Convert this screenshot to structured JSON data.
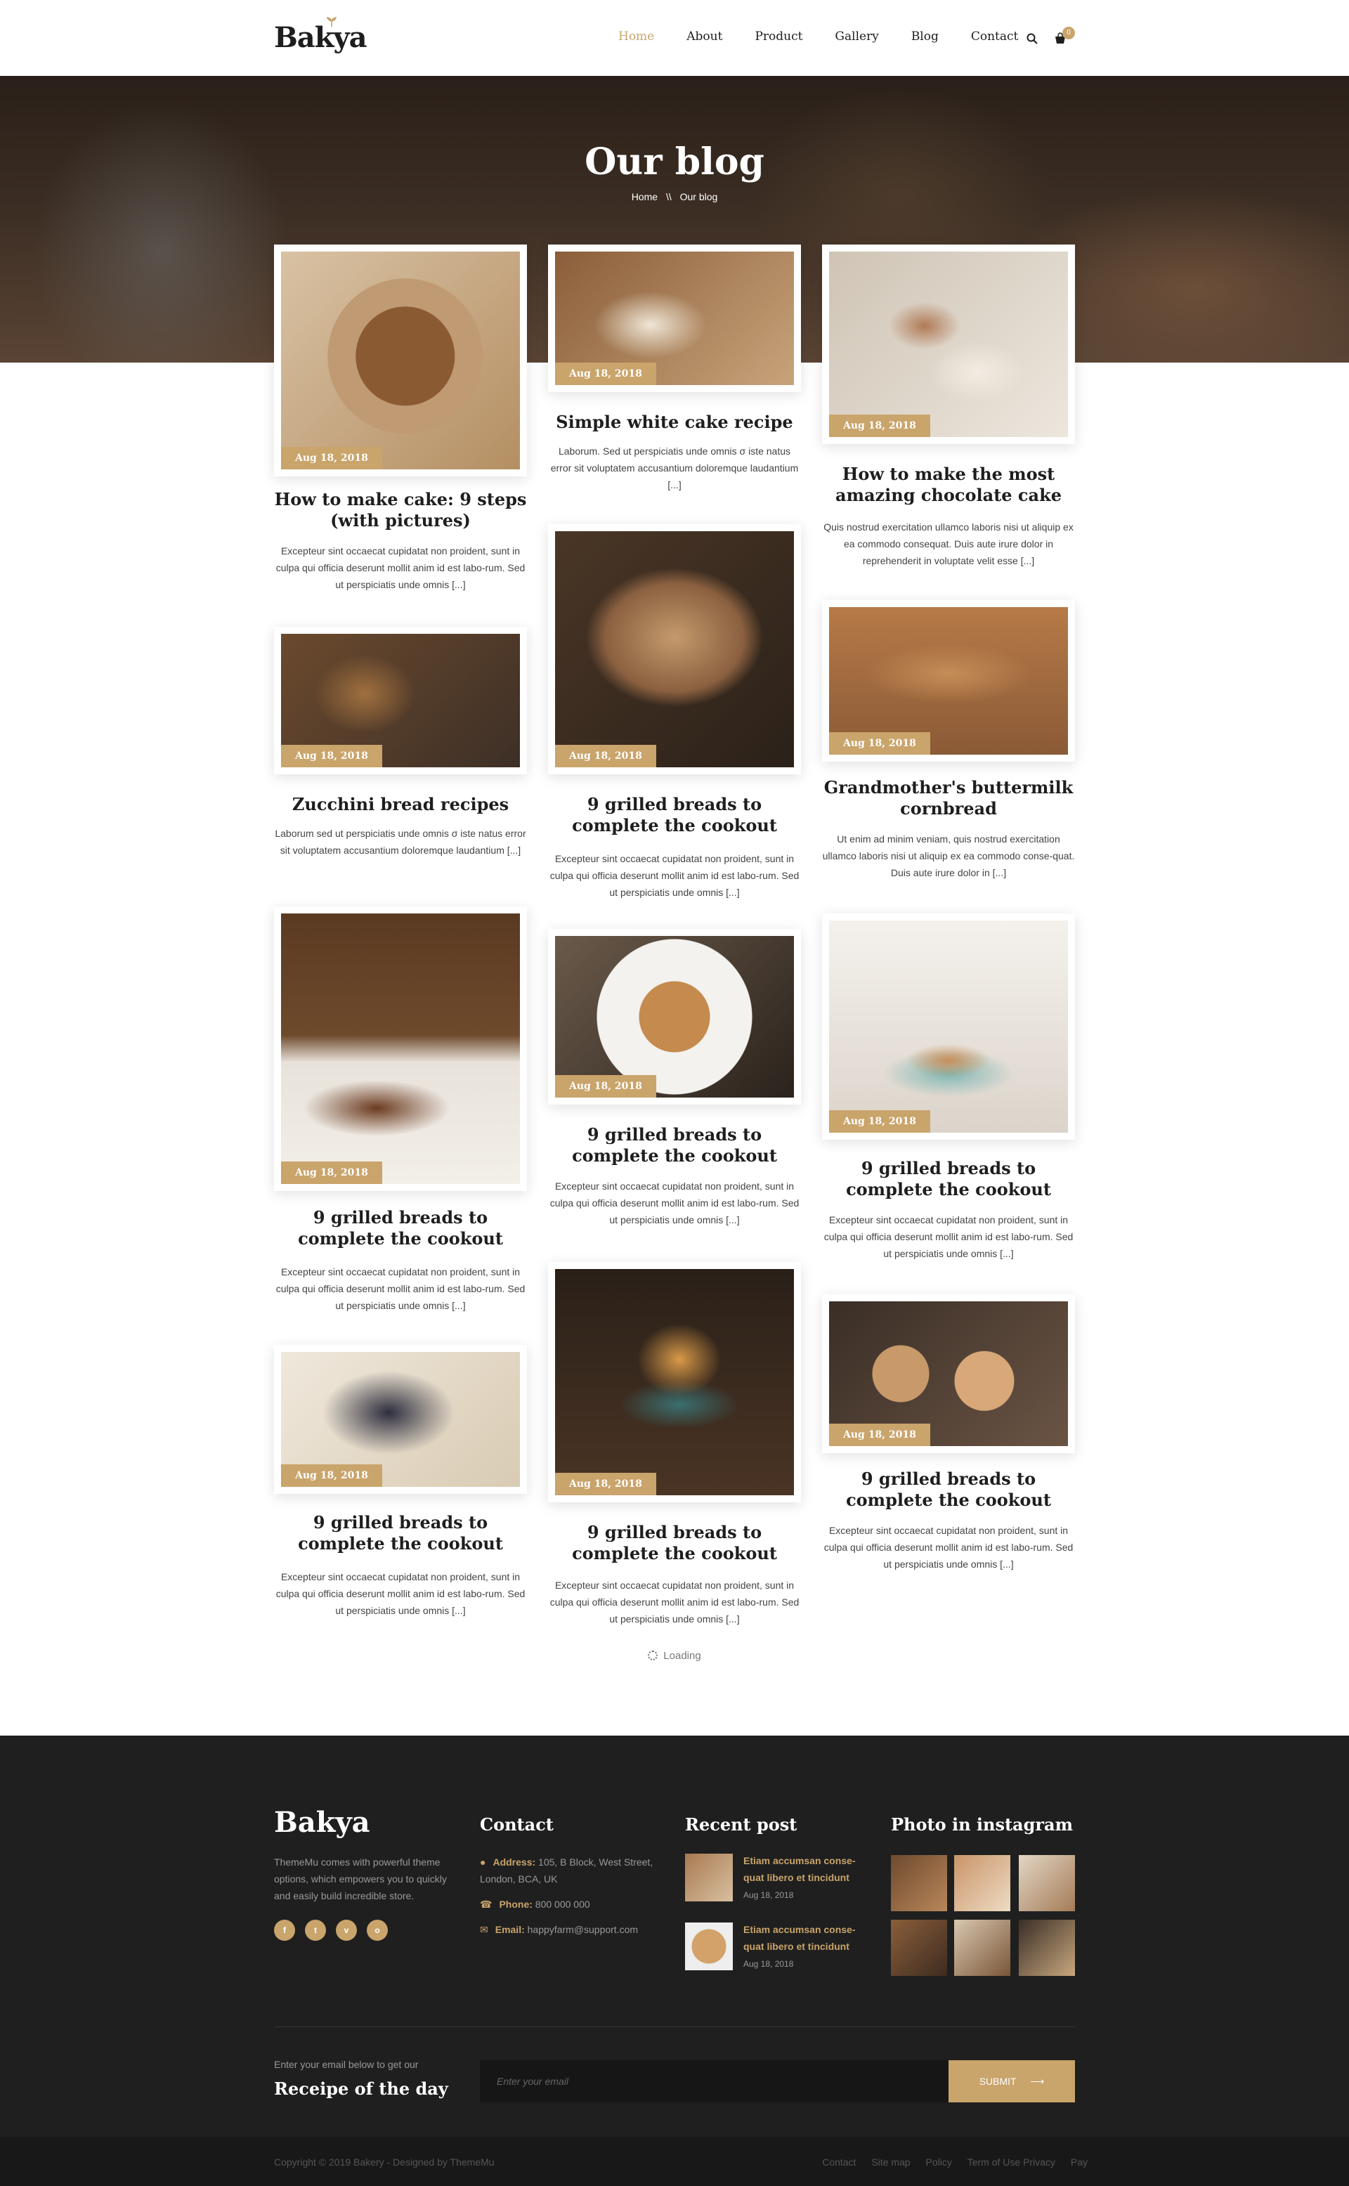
{
  "header": {
    "logo": "Bakya",
    "nav": [
      "Home",
      "About",
      "Product",
      "Gallery",
      "Blog",
      "Contact"
    ],
    "active_nav": "Home",
    "cart_count": "0",
    "search_icon": "search-icon",
    "cart_icon": "cart-icon"
  },
  "hero": {
    "title": "Our blog",
    "breadcrumb_home": "Home",
    "breadcrumb_sep": "\\\\",
    "breadcrumb_current": "Our blog"
  },
  "posts": [
    {
      "date": "Aug 18, 2018",
      "title": "How to make cake: 9 steps (with pictures)",
      "excerpt": "Excepteur sint occaecat cupidatat non proident, sunt in culpa qui officia deserunt mollit anim id est labo-rum. Sed ut perspiciatis unde omnis [...]"
    },
    {
      "date": "Aug 18, 2018",
      "title": "Simple white cake recipe",
      "excerpt": "Laborum. Sed ut perspiciatis unde omnis σ iste natus error sit voluptatem accusantium doloremque laudantium [...]"
    },
    {
      "date": "Aug 18, 2018",
      "title": "How to make the most amazing chocolate cake",
      "excerpt": "Quis nostrud exercitation ullamco laboris nisi ut aliquip ex ea commodo consequat. Duis aute irure dolor in reprehenderit in voluptate velit esse [...]"
    },
    {
      "date": "Aug 18, 2018",
      "title": "Zucchini bread recipes",
      "excerpt": "Laborum sed ut perspiciatis unde omnis σ iste natus error sit voluptatem accusantium doloremque laudantium [...]"
    },
    {
      "date": "Aug 18, 2018",
      "title": "9 grilled breads to complete the cookout",
      "excerpt": "Excepteur sint occaecat cupidatat non proident, sunt in culpa qui officia deserunt mollit anim id est labo-rum. Sed ut perspiciatis unde omnis [...]"
    },
    {
      "date": "Aug 18, 2018",
      "title": "Grandmother's buttermilk cornbread",
      "excerpt": "Ut enim ad minim veniam, quis nostrud exercitation ullamco laboris nisi ut aliquip ex ea commodo conse-quat. Duis aute irure dolor in [...]"
    },
    {
      "date": "Aug 18, 2018",
      "title": "9 grilled breads to complete the cookout",
      "excerpt": "Excepteur sint occaecat cupidatat non proident, sunt in culpa qui officia deserunt mollit anim id est labo-rum. Sed ut perspiciatis unde omnis [...]"
    },
    {
      "date": "Aug 18, 2018",
      "title": "9 grilled breads to complete the cookout",
      "excerpt": "Excepteur sint occaecat cupidatat non proident, sunt in culpa qui officia deserunt mollit anim id est labo-rum. Sed ut perspiciatis unde omnis [...]"
    },
    {
      "date": "Aug 18, 2018",
      "title": "9 grilled breads to complete the cookout",
      "excerpt": "Excepteur sint occaecat cupidatat non proident, sunt in culpa qui officia deserunt mollit anim id est labo-rum. Sed ut perspiciatis unde omnis [...]"
    },
    {
      "date": "Aug 18, 2018",
      "title": "9 grilled breads to complete the cookout",
      "excerpt": "Excepteur sint occaecat cupidatat non proident, sunt in culpa qui officia deserunt mollit anim id est labo-rum. Sed ut perspiciatis unde omnis [...]"
    },
    {
      "date": "Aug 18, 2018",
      "title": "9 grilled breads to complete the cookout",
      "excerpt": "Excepteur sint occaecat cupidatat non proident, sunt in culpa qui officia deserunt mollit anim id est labo-rum. Sed ut perspiciatis unde omnis [...]"
    },
    {
      "date": "Aug 18, 2018",
      "title": "9 grilled breads to complete the cookout",
      "excerpt": "Excepteur sint occaecat cupidatat non proident, sunt in culpa qui officia deserunt mollit anim id est labo-rum. Sed ut perspiciatis unde omnis [...]"
    }
  ],
  "loading": "Loading",
  "footer": {
    "logo": "Bakya",
    "about": "ThemeMu comes with powerful theme options, which empowers you to quickly and easily build incredible store.",
    "social": [
      "f",
      "t",
      "v",
      "o"
    ],
    "contact_title": "Contact",
    "address_label": "Address:",
    "address": "105, B Block, West Street, London, BCA, UK",
    "phone_label": "Phone:",
    "phone": "800 000 000",
    "email_label": "Email:",
    "email": "happyfarm@support.com",
    "recent_title": "Recent post",
    "recent_posts": [
      {
        "title": "Etiam accumsan conse-quat libero et tincidunt",
        "date": "Aug 18, 2018"
      },
      {
        "title": "Etiam accumsan conse-quat libero et tincidunt",
        "date": "Aug 18, 2018"
      }
    ],
    "instagram_title": "Photo in instagram",
    "newsletter_small": "Enter your email below to get our",
    "newsletter_title": "Receipe of the day",
    "email_placeholder": "Enter your email",
    "submit": "SUBMIT",
    "copyright": "Copyright © 2019 Bakery - Designed by ThemeMu",
    "bottom_links": [
      "Contact",
      "Site map",
      "Policy",
      "Term of Use Privacy",
      "Pay"
    ]
  },
  "colors": {
    "accent": "#c9a46b",
    "dark": "#1f1f1f"
  }
}
